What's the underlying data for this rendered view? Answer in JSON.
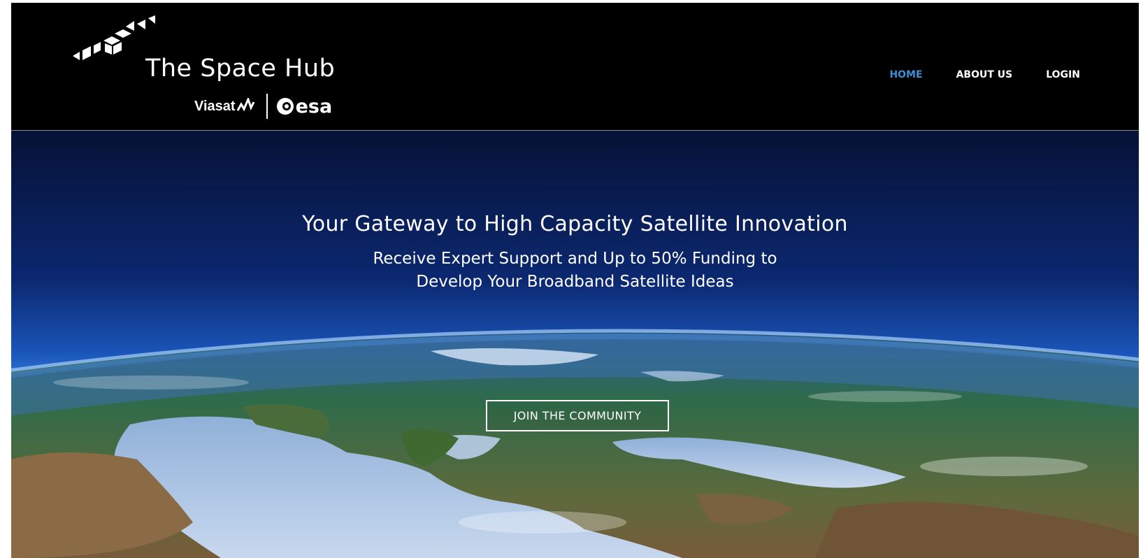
{
  "header": {
    "brand_title": "The Space Hub",
    "partners": {
      "viasat": "Viasat",
      "esa": "esa"
    },
    "nav": [
      {
        "label": "HOME",
        "active": true
      },
      {
        "label": "ABOUT US",
        "active": false
      },
      {
        "label": "LOGIN",
        "active": false
      }
    ]
  },
  "hero": {
    "title": "Your Gateway to High Capacity Satellite Innovation",
    "subtitle_line1": "Receive Expert Support and Up to 50% Funding to",
    "subtitle_line2": "Develop Your Broadband Satellite Ideas",
    "cta_label": "JOIN THE COMMUNITY"
  },
  "colors": {
    "header_bg": "#000000",
    "nav_active": "#3a8fd0",
    "nav_text": "#ffffff",
    "hero_text": "#ffffff"
  },
  "icons": {
    "logo_mark": "triangle-cluster-logo-icon",
    "viasat_wave": "viasat-wave-icon",
    "esa_mark": "esa-circle-icon",
    "hero_background": "earth-from-orbit-image"
  }
}
